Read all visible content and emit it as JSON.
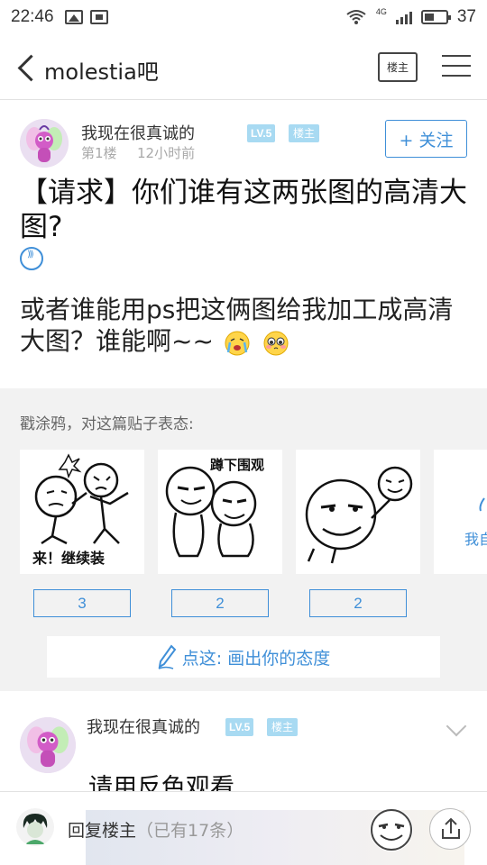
{
  "status_bar": {
    "time": "22:46",
    "network": "4G",
    "battery": "37"
  },
  "header": {
    "title": "molestia吧",
    "floor_host_label": "楼主"
  },
  "post": {
    "author": "我现在很真诚的",
    "level": "LV.5",
    "host_badge": "楼主",
    "floor": "第1楼",
    "time": "12小时前",
    "follow_label": "+ 关注",
    "title": "【请求】你们谁有这两张图的高清大图?",
    "body": "或者谁能用ps把这俩图给我加工成高清大图？谁能啊~~"
  },
  "graffiti": {
    "label": "戳涂鸦，对这篇贴子表态:",
    "card_captions": [
      "来！继续装",
      "蹲下围观",
      ""
    ],
    "partial_card_label": "我自",
    "counts": [
      "3",
      "2",
      "2"
    ],
    "draw_label": "点这: 画出你的态度"
  },
  "reply": {
    "author": "我现在很真诚的",
    "level": "LV.5",
    "host_badge": "楼主",
    "text": "请用反色观看"
  },
  "bottom_bar": {
    "reply_label": "回复楼主",
    "reply_count": "（已有17条）"
  },
  "colors": {
    "accent": "#3f8fd8",
    "badge": "#a8daf2",
    "section_bg": "#f2f2f2"
  }
}
